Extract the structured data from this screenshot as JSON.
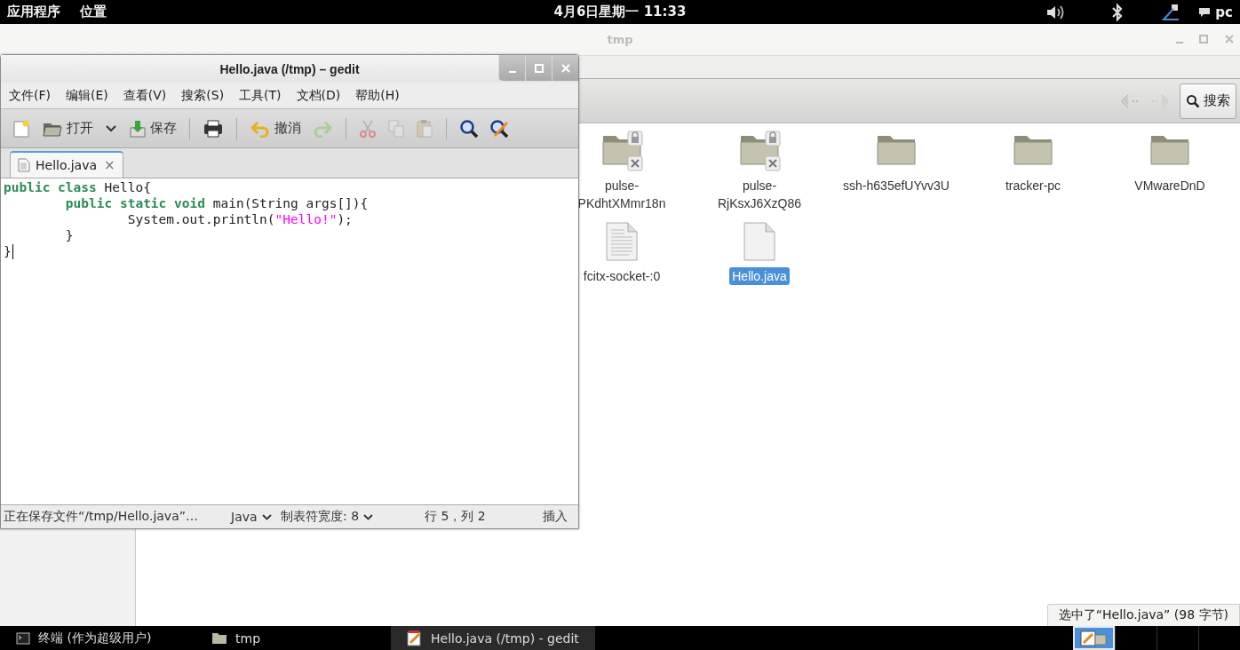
{
  "top_bar": {
    "menus": [
      "应用程序",
      "位置"
    ],
    "clock": "4月6日星期一 11:33",
    "user": "pc"
  },
  "file_manager": {
    "title": "tmp",
    "search_button": "搜索",
    "items": [
      {
        "kind": "locked-folder",
        "label": [
          "pulse-",
          "PKdhtXMmr18n"
        ],
        "selected": false
      },
      {
        "kind": "locked-folder",
        "label": [
          "pulse-",
          "RjKsxJ6XzQ86"
        ],
        "selected": false
      },
      {
        "kind": "folder",
        "label": [
          "ssh-h635efUYvv3U"
        ],
        "selected": false
      },
      {
        "kind": "folder",
        "label": [
          "tracker-pc"
        ],
        "selected": false
      },
      {
        "kind": "folder",
        "label": [
          "VMwareDnD"
        ],
        "selected": false
      },
      {
        "kind": "text-file",
        "label": [
          "fcitx-socket-:0"
        ],
        "selected": false
      },
      {
        "kind": "file",
        "label": [
          "Hello.java"
        ],
        "selected": true
      }
    ],
    "status_tooltip": "选中了“Hello.java” (98 字节)"
  },
  "gedit": {
    "title": "Hello.java (/tmp) – gedit",
    "menu": [
      "文件(F)",
      "编辑(E)",
      "查看(V)",
      "搜索(S)",
      "工具(T)",
      "文档(D)",
      "帮助(H)"
    ],
    "toolbar": [
      {
        "kind": "button",
        "disabled": false
      },
      {
        "kind": "button",
        "label": "打开",
        "disabled": false
      },
      {
        "kind": "menu-arrow"
      },
      {
        "kind": "button",
        "label": "保存",
        "disabled": false
      },
      {
        "kind": "separator"
      },
      {
        "kind": "button",
        "disabled": false
      },
      {
        "kind": "separator"
      },
      {
        "kind": "button",
        "label": "撤消",
        "disabled": false
      },
      {
        "kind": "button",
        "disabled": true
      },
      {
        "kind": "separator"
      },
      {
        "kind": "button",
        "disabled": true
      },
      {
        "kind": "button",
        "disabled": true
      },
      {
        "kind": "button",
        "disabled": true
      },
      {
        "kind": "separator"
      },
      {
        "kind": "button",
        "disabled": false
      },
      {
        "kind": "button",
        "disabled": false
      }
    ],
    "tabs": [
      {
        "label": "Hello.java",
        "close": "×",
        "selected": true
      }
    ],
    "code": [
      {
        "cursor": false,
        "tokens": [
          {
            "kind": "keyword",
            "text": "public class"
          },
          {
            "kind": "plain",
            "text": " Hello{"
          }
        ]
      },
      {
        "cursor": false,
        "tokens": [
          {
            "kind": "keyword",
            "text": "        public static void"
          },
          {
            "kind": "plain",
            "text": " main(String args[]){"
          }
        ]
      },
      {
        "cursor": false,
        "tokens": [
          {
            "kind": "plain",
            "text": "                System.out.println("
          },
          {
            "kind": "string",
            "text": "\"Hello!\""
          },
          {
            "kind": "plain",
            "text": ");"
          }
        ]
      },
      {
        "cursor": false,
        "tokens": [
          {
            "kind": "plain",
            "text": "        }"
          }
        ]
      },
      {
        "cursor": true,
        "tokens": [
          {
            "kind": "plain",
            "text": "}"
          }
        ]
      }
    ],
    "status": {
      "message": "正在保存文件“/tmp/Hello.java”…",
      "language": "Java",
      "tab_width": "制表符宽度:  8",
      "position": "行 5，列 2",
      "mode": "插入"
    }
  },
  "taskbar": {
    "tasks": [
      {
        "label": "终端 (作为超级用户)",
        "selected": false
      },
      {
        "label": "tmp",
        "selected": false
      },
      {
        "label": "Hello.java (/tmp) - gedit",
        "selected": true
      }
    ],
    "workspaces": [
      {
        "selected": true
      },
      {
        "selected": false
      },
      {
        "selected": false
      },
      {
        "selected": false
      }
    ]
  }
}
